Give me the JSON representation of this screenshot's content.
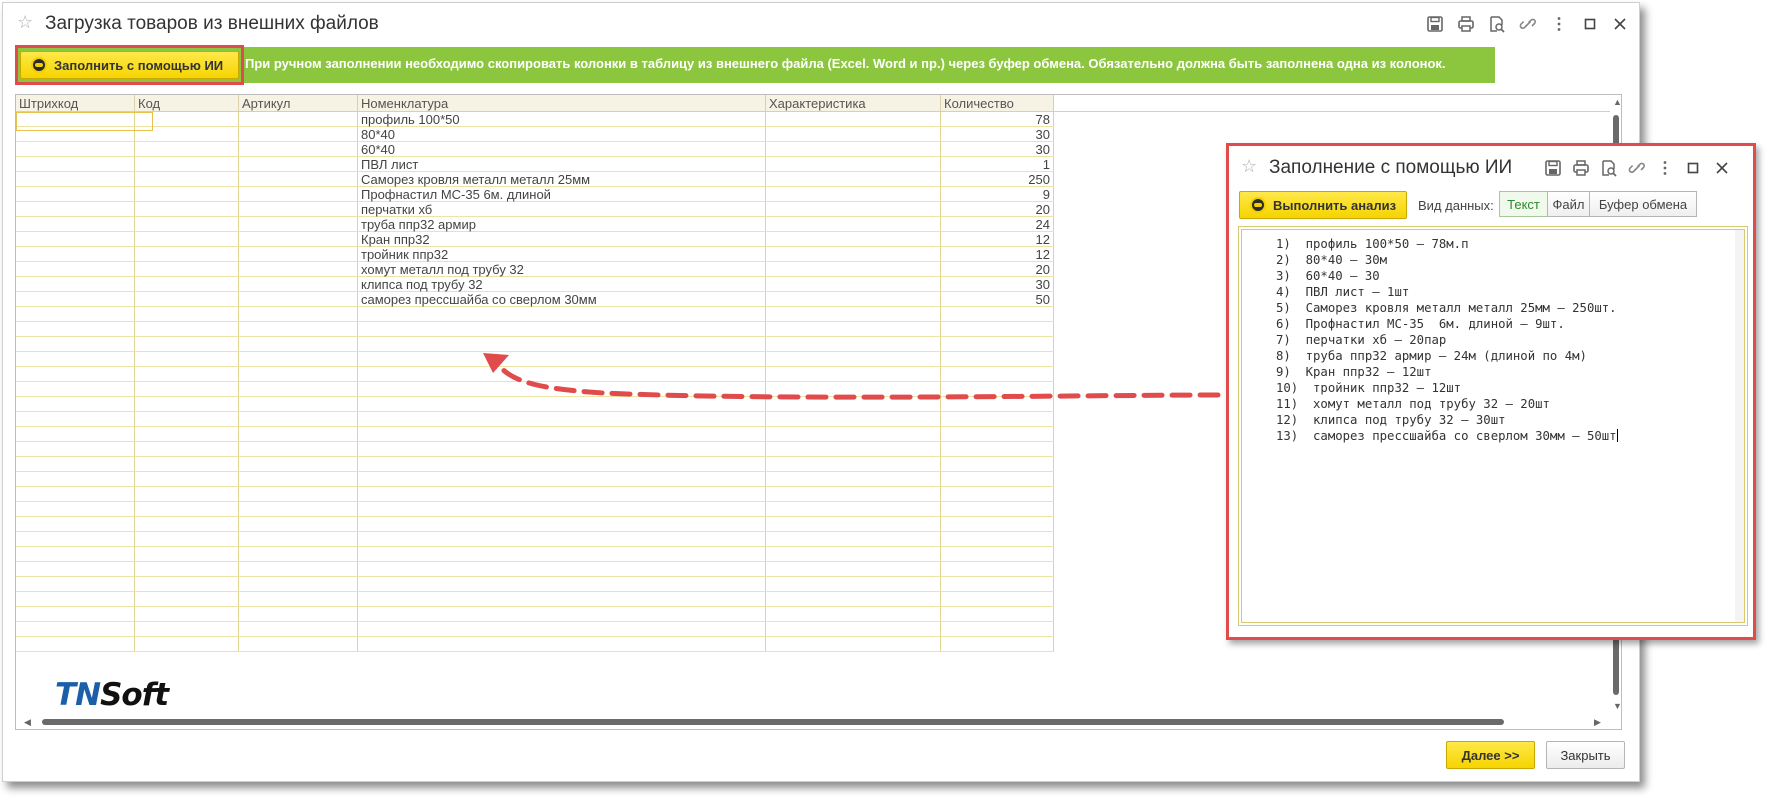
{
  "main_window": {
    "title": "Загрузка товаров из внешних файлов",
    "toolbar_icons": [
      "save-icon",
      "print-icon",
      "preview-icon",
      "link-icon",
      "more-icon",
      "maximize-icon",
      "close-icon"
    ]
  },
  "info_bar": {
    "ai_button_label": "Заполнить с помощью ИИ",
    "text": "При ручном заполнении необходимо скопировать колонки в таблицу из внешнего файла (Excel. Word и пр.) через буфер обмена. Обязательно должна быть заполнена одна из колонок.",
    "color": "#8cc63e"
  },
  "table": {
    "headers": [
      "Штрихкод",
      "Код",
      "Артикул",
      "Номенклатура",
      "Характеристика",
      "Количество"
    ],
    "rows": [
      {
        "nomenclature": "профиль 100*50",
        "qty": "78"
      },
      {
        "nomenclature": "80*40",
        "qty": "30"
      },
      {
        "nomenclature": "60*40",
        "qty": "30"
      },
      {
        "nomenclature": "ПВЛ лист",
        "qty": "1"
      },
      {
        "nomenclature": "Саморез кровля металл металл 25мм",
        "qty": "250"
      },
      {
        "nomenclature": "Профнастил МС-35 6м. длиной",
        "qty": "9"
      },
      {
        "nomenclature": "перчатки хб",
        "qty": "20"
      },
      {
        "nomenclature": "труба ппр32 армир",
        "qty": "24"
      },
      {
        "nomenclature": "Кран ппр32",
        "qty": "12"
      },
      {
        "nomenclature": "тройник ппр32",
        "qty": "12"
      },
      {
        "nomenclature": "хомут металл под трубу 32",
        "qty": "20"
      },
      {
        "nomenclature": "клипса под трубу 32",
        "qty": "30"
      },
      {
        "nomenclature": "саморез прессшайба со сверлом 30мм",
        "qty": "50"
      }
    ]
  },
  "buttons": {
    "next": "Далее >>",
    "close": "Закрыть"
  },
  "logo": {
    "part1": "TN",
    "part2": "Soft"
  },
  "popup": {
    "title": "Заполнение с помощью ИИ",
    "analyze_button": "Выполнить анализ",
    "data_type_label": "Вид данных:",
    "data_type_options": [
      "Текст",
      "Файл",
      "Буфер обмена"
    ],
    "selected_data_type": "Текст",
    "text_lines": [
      "1)  профиль 100*50 – 78м.п",
      "2)  80*40 – 30м",
      "3)  60*40 – 30",
      "4)  ПВЛ лист – 1шт",
      "5)  Саморез кровля металл металл 25мм – 250шт.",
      "6)  Профнастил МС-35  6м. длиной – 9шт.",
      "7)  перчатки хб – 20пар",
      "8)  труба ппр32 армир – 24м (длиной по 4м)",
      "9)  Кран ппр32 – 12шт",
      "10)  тройник ппр32 – 12шт",
      "11)  хомут металл под трубу 32 – 20шт",
      "12)  клипса под трубу 32 – 30шт",
      "13)  саморез прессшайба со сверлом 30мм – 50шт"
    ]
  },
  "colors": {
    "accent_yellow": "#f5d400",
    "highlight_red": "#e04b4b",
    "active_tab_green": "#2b8a2b"
  }
}
